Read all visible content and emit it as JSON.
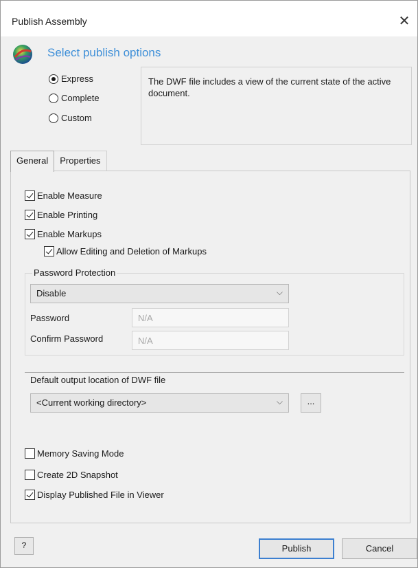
{
  "window": {
    "title": "Publish Assembly"
  },
  "header": {
    "heading": "Select publish options",
    "options": [
      {
        "label": "Express",
        "selected": true
      },
      {
        "label": "Complete",
        "selected": false
      },
      {
        "label": "Custom",
        "selected": false
      }
    ],
    "description": "The DWF file includes a view of the current state of the active document."
  },
  "tabs": [
    {
      "label": "General",
      "active": true
    },
    {
      "label": "Properties",
      "active": false
    }
  ],
  "general": {
    "enable_measure": {
      "label": "Enable Measure",
      "checked": true
    },
    "enable_printing": {
      "label": "Enable Printing",
      "checked": true
    },
    "enable_markups": {
      "label": "Enable Markups",
      "checked": true
    },
    "allow_editing": {
      "label": "Allow Editing and Deletion of Markups",
      "checked": true
    },
    "password_protection": {
      "title": "Password Protection",
      "mode": "Disable",
      "password_label": "Password",
      "password_value": "N/A",
      "confirm_label": "Confirm Password",
      "confirm_value": "N/A"
    },
    "output": {
      "label": "Default output location of DWF file",
      "value": "<Current working directory>",
      "browse_label": "..."
    },
    "memory_saving": {
      "label": "Memory Saving Mode",
      "checked": false
    },
    "snapshot_2d": {
      "label": "Create 2D Snapshot",
      "checked": false
    },
    "display_viewer": {
      "label": "Display Published File in Viewer",
      "checked": true
    }
  },
  "footer": {
    "help_label": "?",
    "publish_label": "Publish",
    "cancel_label": "Cancel"
  },
  "icons": {
    "close": "close-icon",
    "app": "dwf-globe-icon",
    "chevron": "chevron-down-icon",
    "help": "help-icon"
  },
  "colors": {
    "accent": "#3e8fd8",
    "default_button_border": "#3c7fd0",
    "dialog_bg": "#f0f0f0"
  }
}
